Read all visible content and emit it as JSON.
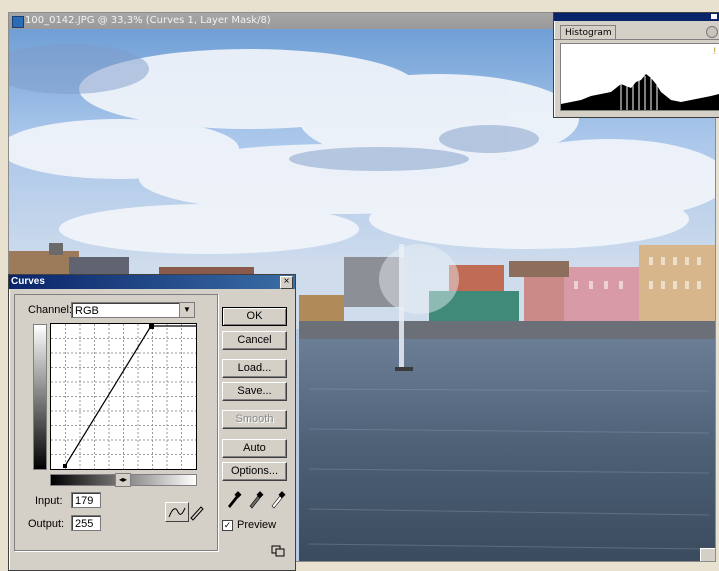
{
  "document": {
    "title": "100_0142.JPG @ 33,3% (Curves 1, Layer Mask/8)"
  },
  "histogram_panel": {
    "tab_label": "Histogram",
    "warning": "!"
  },
  "curves_dialog": {
    "title": "Curves",
    "close": "×",
    "channel_label": "Channel:",
    "channel_value": "RGB",
    "input_label": "Input:",
    "input_value": "179",
    "output_label": "Output:",
    "output_value": "255",
    "buttons": {
      "ok": "OK",
      "cancel": "Cancel",
      "load": "Load...",
      "save": "Save...",
      "smooth": "Smooth",
      "auto": "Auto",
      "options": "Options..."
    },
    "preview_label": "Preview",
    "preview_checked": "✓",
    "curve": {
      "input": 179,
      "output": 255
    }
  },
  "colors": {
    "titlebar_active": "#0a246a",
    "dialog_face": "#d4d0c8",
    "sky": "#b7cbe6",
    "water": "#4e6278"
  }
}
